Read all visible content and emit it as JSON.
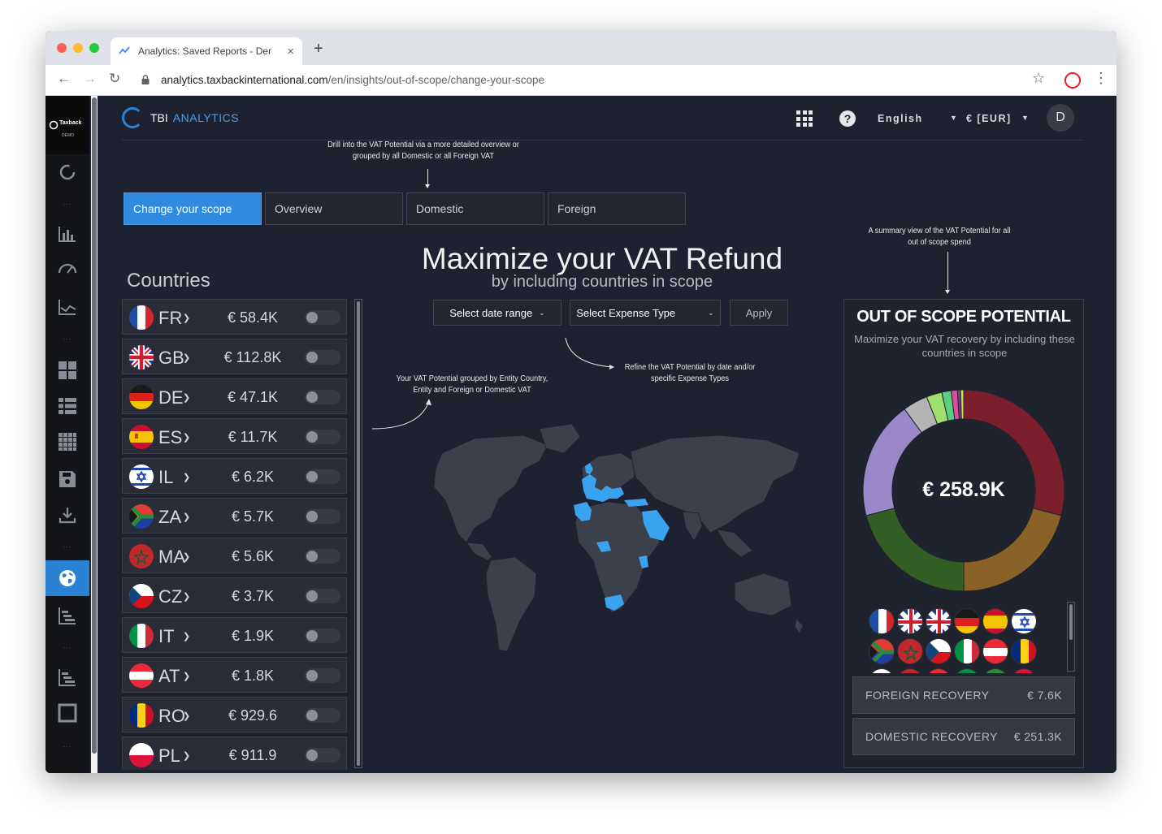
{
  "browser": {
    "tab_title": "Analytics: Saved Reports - Der",
    "tab_close": "×",
    "new_tab": "+",
    "url_domain": "analytics.taxbackinternational.com",
    "url_path": "/en/insights/out-of-scope/change-your-scope"
  },
  "rail": {
    "logo_text": "Taxback",
    "logo_sub": "DEMO"
  },
  "header": {
    "brand": "TBI",
    "brand_product": "ANALYTICS",
    "help": "?",
    "language": "English",
    "currency": "€ [EUR]",
    "avatar": "D"
  },
  "notes": {
    "tabs_note": "Drill into the VAT Potential via a more detailed overview or grouped by all Domestic or all Foreign VAT",
    "summary_note": "A summary view of the VAT Potential for all out of scope spend",
    "map_note": "Your VAT Potential grouped by Entity Country, Entity and Foreign or Domestic VAT",
    "filter_note": "Refine the VAT Potential by date and/or specific Expense Types"
  },
  "tabs": [
    {
      "label": "Change your scope",
      "active": true
    },
    {
      "label": "Overview",
      "active": false
    },
    {
      "label": "Domestic",
      "active": false
    },
    {
      "label": "Foreign",
      "active": false
    }
  ],
  "hero": {
    "title": "Maximize your VAT Refund",
    "subtitle": "by including countries in scope"
  },
  "filters": {
    "date_range": "Select date range",
    "expense_type": "Select Expense Type",
    "apply": "Apply"
  },
  "countries": {
    "title": "Countries",
    "items": [
      {
        "code": "FR",
        "value": "€ 58.4K",
        "enabled": false
      },
      {
        "code": "GB",
        "value": "€ 112.8K",
        "enabled": false
      },
      {
        "code": "DE",
        "value": "€ 47.1K",
        "enabled": false
      },
      {
        "code": "ES",
        "value": "€ 11.7K",
        "enabled": false
      },
      {
        "code": "IL",
        "value": "€ 6.2K",
        "enabled": false
      },
      {
        "code": "ZA",
        "value": "€ 5.7K",
        "enabled": false
      },
      {
        "code": "MA",
        "value": "€ 5.6K",
        "enabled": false
      },
      {
        "code": "CZ",
        "value": "€ 3.7K",
        "enabled": false
      },
      {
        "code": "IT",
        "value": "€ 1.9K",
        "enabled": false
      },
      {
        "code": "AT",
        "value": "€ 1.8K",
        "enabled": false
      },
      {
        "code": "RO",
        "value": "€ 929.6",
        "enabled": false
      },
      {
        "code": "PL",
        "value": "€ 911.9",
        "enabled": false
      }
    ]
  },
  "summary": {
    "title": "OUT OF SCOPE POTENTIAL",
    "subtitle": "Maximize your VAT recovery by including these countries in scope",
    "total": "€ 258.9K",
    "foreign_label": "FOREIGN RECOVERY",
    "foreign_value": "€ 7.6K",
    "domestic_label": "DOMESTIC RECOVERY",
    "domestic_value": "€ 251.3K"
  },
  "colors": {
    "accent": "#2f8be0",
    "map_highlight": "#3aa3ef",
    "map_land": "#3c404b",
    "donut": [
      "#7a1f2b",
      "#8a6227",
      "#335f25",
      "#9b88c9",
      "#b4b4b4",
      "#9fe06f",
      "#5ad07f",
      "#e04b9e",
      "#7a3c8f",
      "#d3e03b"
    ]
  },
  "chart_data": {
    "type": "pie",
    "title": "€ 258.9K",
    "series": [
      {
        "values": [
          29,
          21,
          21,
          19,
          4,
          2.5,
          1.5,
          1,
          0.5,
          0.5
        ]
      }
    ]
  }
}
